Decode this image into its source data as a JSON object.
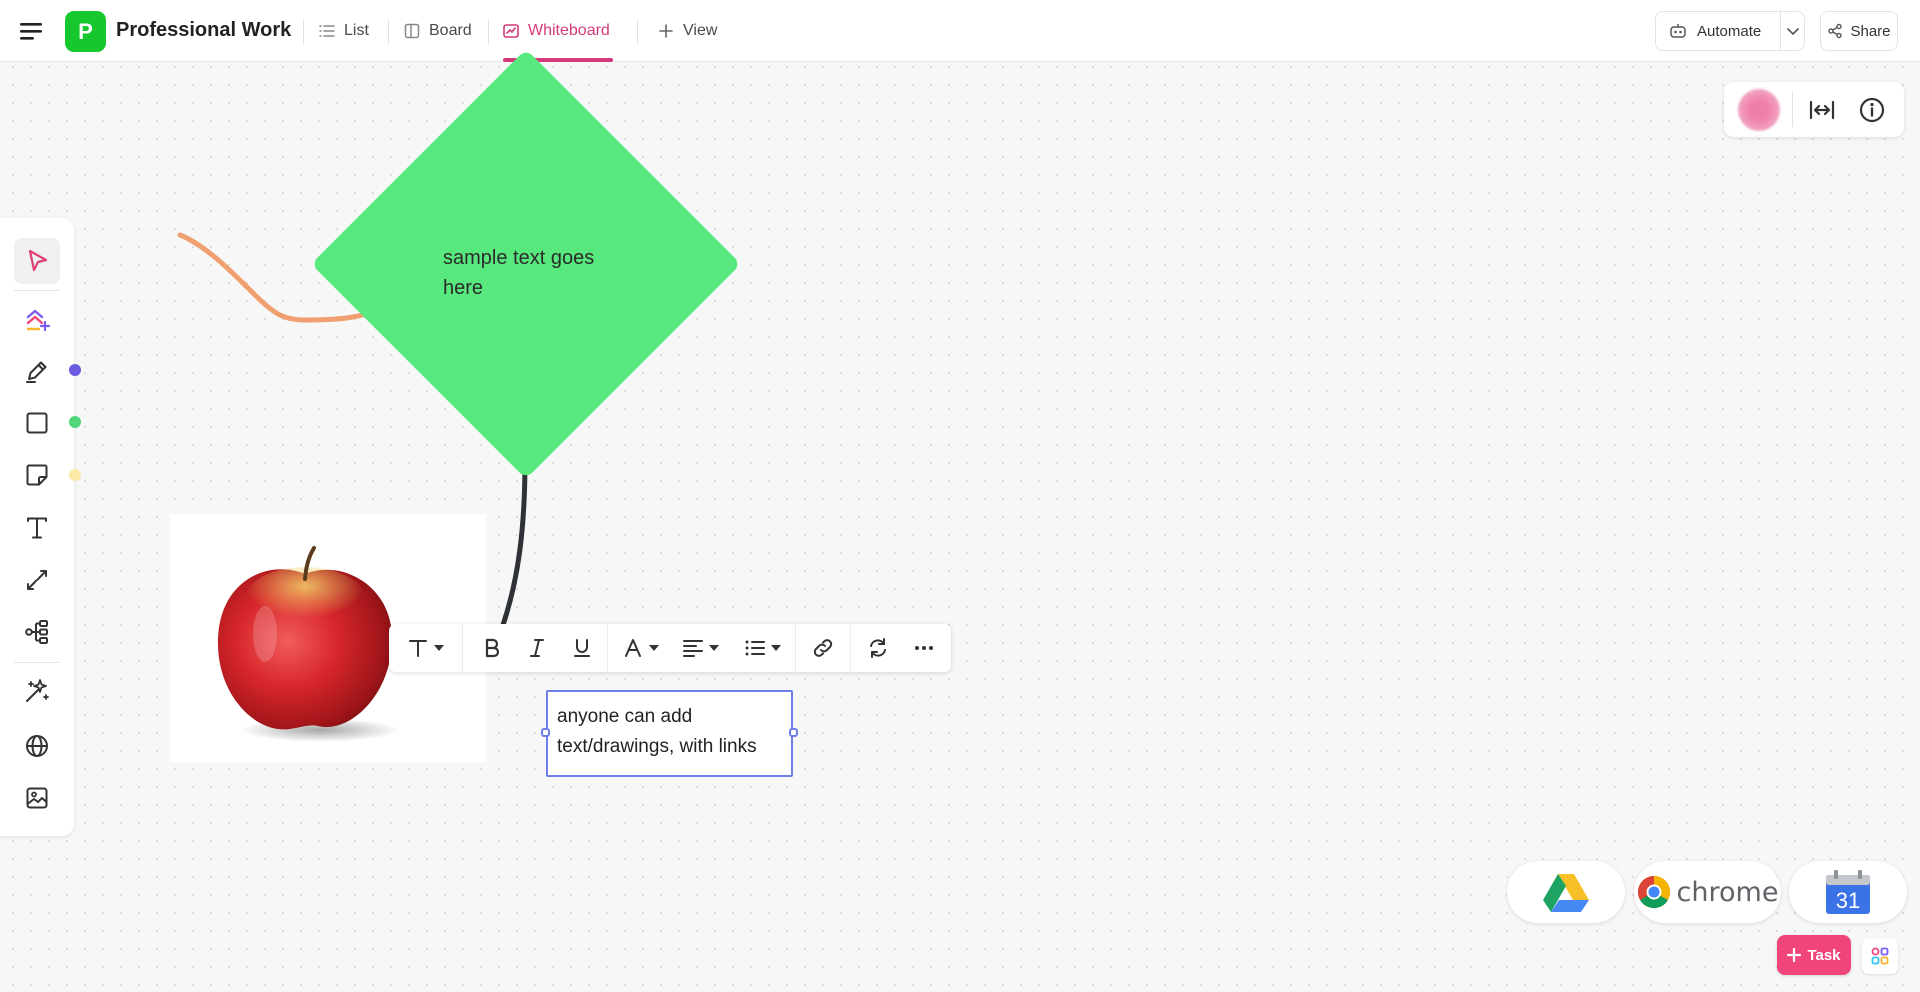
{
  "header": {
    "space_initial": "P",
    "space_title": "Professional Work",
    "tabs": [
      {
        "label": "List",
        "icon": "list-icon"
      },
      {
        "label": "Board",
        "icon": "board-icon"
      },
      {
        "label": "Whiteboard",
        "icon": "whiteboard-icon",
        "active": true
      },
      {
        "label": "View",
        "icon": "plus-icon"
      }
    ],
    "automate_label": "Automate",
    "share_label": "Share"
  },
  "colors": {
    "accent": "#d33a7c",
    "space_avatar": "#16c72e",
    "diamond": "#57e87e",
    "marker_stroke": "#f0a070",
    "connector_stroke": "#2e3135",
    "selection": "#6f7de9",
    "task_button": "#f0457a",
    "pen_color_dot": "#6a5be0",
    "shape_color_dot": "#4fd67a",
    "sticky_color_dot": "#fbe9a6"
  },
  "toolbar": {
    "tools": [
      {
        "name": "select",
        "icon": "cursor-icon",
        "active": true
      },
      {
        "name": "clickup-ai",
        "icon": "ai-shapes-icon"
      },
      {
        "name": "pen",
        "icon": "pen-icon"
      },
      {
        "name": "shape",
        "icon": "square-icon"
      },
      {
        "name": "sticky-note",
        "icon": "sticky-note-icon"
      },
      {
        "name": "text",
        "icon": "text-icon"
      },
      {
        "name": "connector",
        "icon": "connector-icon"
      },
      {
        "name": "mind-map",
        "icon": "mind-map-icon"
      },
      {
        "name": "ai-generate",
        "icon": "sparkles-icon"
      },
      {
        "name": "embed-web",
        "icon": "globe-icon"
      },
      {
        "name": "image",
        "icon": "image-icon"
      }
    ]
  },
  "canvas": {
    "diamond_text": "sample text goes here",
    "text_box": "anyone can add text/drawings, with links"
  },
  "format_toolbar": {
    "items": [
      "text-style",
      "bold",
      "italic",
      "underline",
      "font-color",
      "align",
      "list",
      "link",
      "convert",
      "more"
    ]
  },
  "dock": {
    "apps": [
      {
        "name": "Google Drive",
        "icon": "google-drive-icon"
      },
      {
        "name": "chrome",
        "label": "chrome",
        "icon": "chrome-icon"
      },
      {
        "name": "Google Calendar",
        "label": "31",
        "icon": "calendar-icon"
      }
    ]
  },
  "footer": {
    "task_label": "Task"
  }
}
